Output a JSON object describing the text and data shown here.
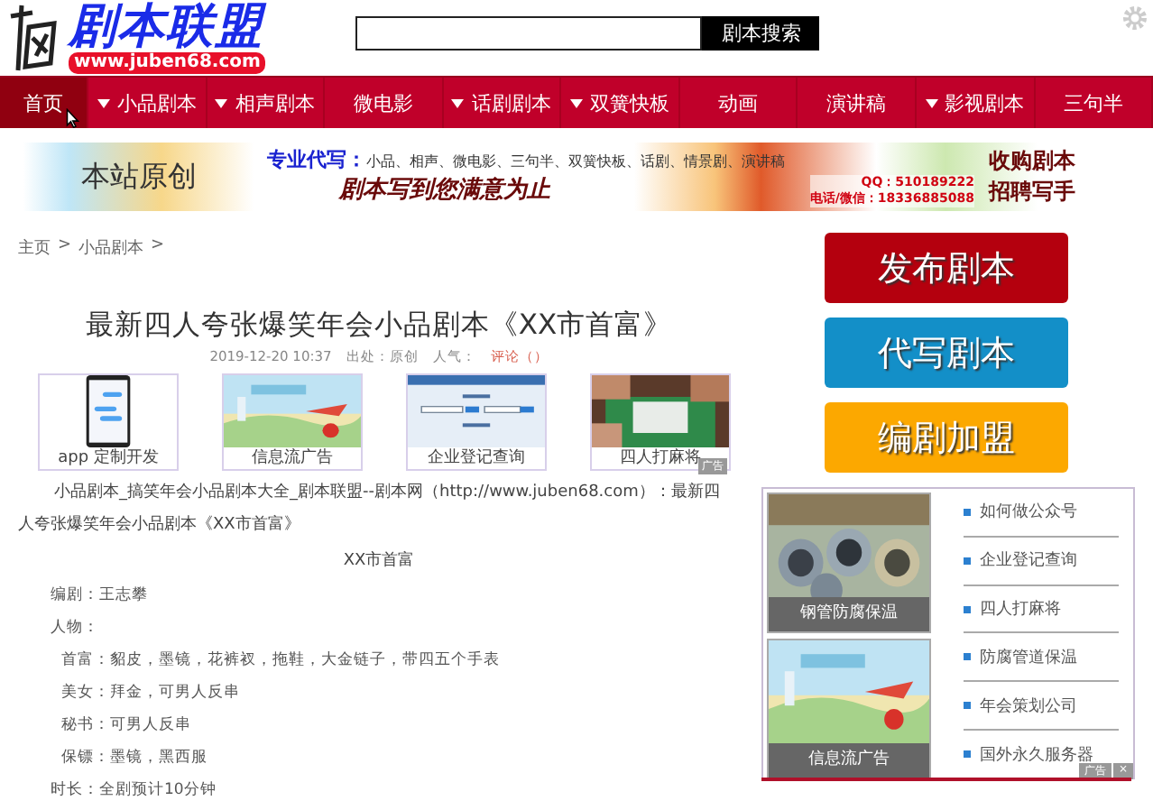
{
  "header": {
    "logo_title": "剧本联盟",
    "logo_url": "www.juben68.com",
    "search": {
      "button": "剧本搜索"
    }
  },
  "nav": [
    {
      "label": "首页",
      "dropdown": false,
      "selected": true
    },
    {
      "label": "小品剧本",
      "dropdown": true,
      "selected": false
    },
    {
      "label": "相声剧本",
      "dropdown": true,
      "selected": false
    },
    {
      "label": "微电影",
      "dropdown": false,
      "selected": false
    },
    {
      "label": "话剧剧本",
      "dropdown": true,
      "selected": false
    },
    {
      "label": "双簧快板",
      "dropdown": true,
      "selected": false
    },
    {
      "label": "动画",
      "dropdown": false,
      "selected": false
    },
    {
      "label": "演讲稿",
      "dropdown": false,
      "selected": false
    },
    {
      "label": "影视剧本",
      "dropdown": true,
      "selected": false
    },
    {
      "label": "三句半",
      "dropdown": false,
      "selected": false
    }
  ],
  "banner": {
    "label": "本站原创",
    "headline": "专业代写：",
    "services": "小品、相声、微电影、三句半、双簧快板、话剧、情景剧、演讲稿",
    "slogan": "剧本写到您满意为止",
    "qq": "QQ：510189222",
    "phone": "电话/微信：18336885088",
    "buy": "收购剧本",
    "hire": "招聘写手"
  },
  "breadcrumb": {
    "separator": ">",
    "items": [
      "主页",
      "小品剧本"
    ]
  },
  "article": {
    "title": "最新四人夸张爆笑年会小品剧本《XX市首富》",
    "date": "2019-12-20 10:37",
    "source": "出处：原创",
    "popularity": "人气：",
    "comments": "评论（）",
    "ads": [
      {
        "caption": "app 定制开发",
        "kind": "phone"
      },
      {
        "caption": "信息流广告",
        "kind": "landscape"
      },
      {
        "caption": "企业登记查询",
        "kind": "form"
      },
      {
        "caption": "四人打麻将"
      }
    ],
    "ad_badge": "广告",
    "intro": "小品剧本_搞笑年会小品剧本大全_剧本联盟--剧本网（http://www.juben68.com）：最新四人夸张爆笑年会小品剧本《XX市首富》",
    "play_title": "XX市首富",
    "lines": [
      {
        "text": "编剧：王志攀",
        "kind": "field"
      },
      {
        "text": "人物：",
        "kind": "field"
      },
      {
        "text": "首富：貂皮，墨镜，花裤衩，拖鞋，大金链子，带四五个手表",
        "kind": "role"
      },
      {
        "text": "美女：拜金，可男人反串",
        "kind": "role"
      },
      {
        "text": "秘书：可男人反串",
        "kind": "role"
      },
      {
        "text": "保镖：墨镜，黑西服",
        "kind": "role"
      },
      {
        "text": "时长：全剧预计10分钟",
        "kind": "field"
      }
    ]
  },
  "sidebar": {
    "buttons": [
      {
        "label": "发布剧本",
        "color": "#b4000e"
      },
      {
        "label": "代写剧本",
        "color": "#138fc8"
      },
      {
        "label": "编剧加盟",
        "color": "#fca800"
      }
    ],
    "ad_box": {
      "cards": [
        {
          "caption": "钢管防腐保温",
          "kind": "pipes"
        },
        {
          "caption": "信息流广告",
          "kind": "landscape"
        }
      ],
      "links": [
        "如何做公众号",
        "企业登记查询",
        "四人打麻将",
        "防腐管道保温",
        "年会策划公司",
        "国外永久服务器"
      ],
      "label": "广告",
      "close": "×"
    }
  }
}
